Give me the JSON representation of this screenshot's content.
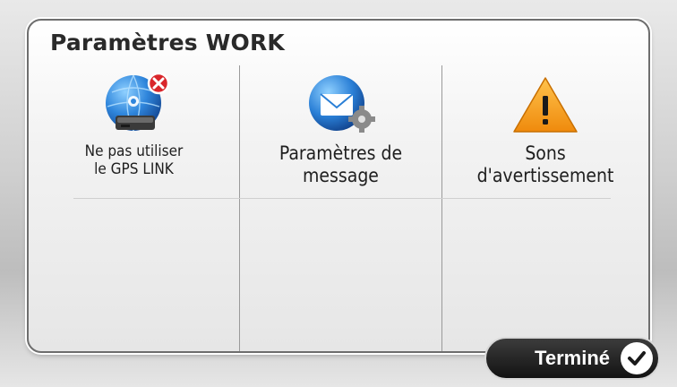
{
  "screen": {
    "title": "Paramètres WORK"
  },
  "items": [
    {
      "label_line1": "Ne pas utiliser",
      "label_line2": "le GPS LINK",
      "icon": "gps-link-off-icon"
    },
    {
      "label_line1": "Paramètres de",
      "label_line2": "message",
      "icon": "message-settings-icon"
    },
    {
      "label_line1": "Sons",
      "label_line2": "d'avertissement",
      "icon": "warning-icon"
    }
  ],
  "done_button": {
    "label": "Terminé",
    "icon": "checkmark-icon"
  },
  "colors": {
    "accent_blue": "#1e6fc4",
    "warning_orange": "#f39a12",
    "error_red": "#d9262b",
    "button_dark": "#1a1a1a"
  }
}
